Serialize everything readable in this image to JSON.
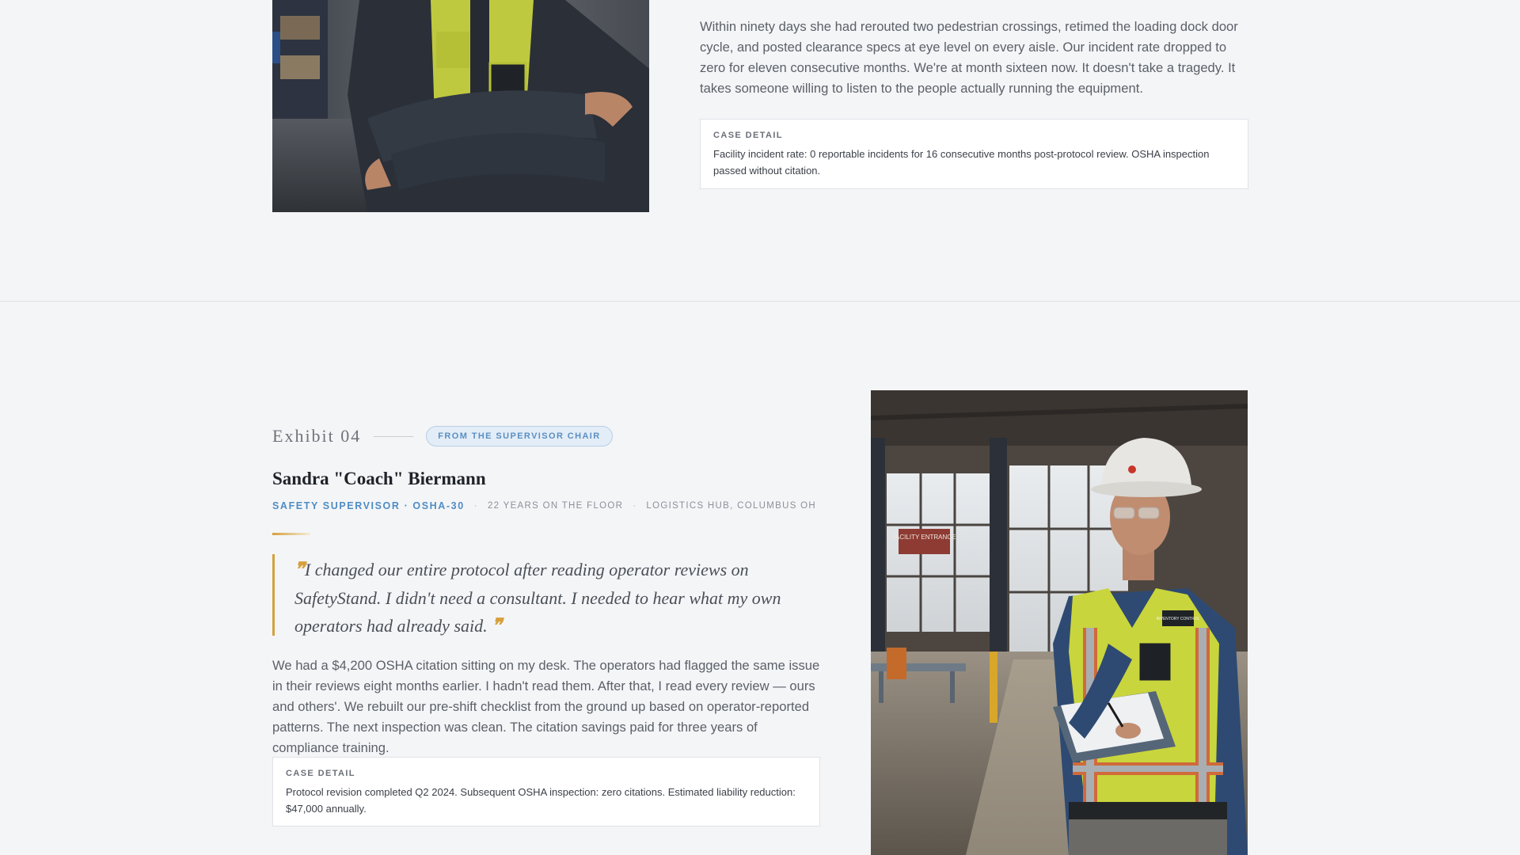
{
  "exhibit_prev": {
    "photo_alt": "Worker in high-visibility vest with arms crossed",
    "body": "Within ninety days she had rerouted two pedestrian crossings, retimed the loading dock door cycle, and posted clearance specs at eye level on every aisle. Our incident rate dropped to zero for eleven consecutive months. We're at month sixteen now. It doesn't take a tragedy. It takes someone willing to listen to the people actually running the equipment.",
    "case_label": "CASE DETAIL",
    "case_text": "Facility incident rate: 0 reportable incidents for 16 consecutive months post-protocol review. OSHA inspection passed without citation."
  },
  "exhibit": {
    "number": "Exhibit 04",
    "badge": "FROM THE SUPERVISOR CHAIR",
    "name": "Sandra \"Coach\" Biermann",
    "role": "SAFETY SUPERVISOR · OSHA-30",
    "tenure": "22 YEARS ON THE FLOOR",
    "location": "LOGISTICS HUB, COLUMBUS OH",
    "quote": "I changed our entire protocol after reading operator reviews on SafetyStand. I didn't need a consultant. I needed to hear what my own operators had already said.",
    "body": "We had a $4,200 OSHA citation sitting on my desk. The operators had flagged the same issue in their reviews eight months earlier. I hadn't read them. After that, I read every review — ours and others'. We rebuilt our pre-shift checklist from the ground up based on operator-reported patterns. The next inspection was clean. The citation savings paid for three years of compliance training.",
    "case_label": "CASE DETAIL",
    "case_text": "Protocol revision completed Q2 2024. Subsequent OSHA inspection: zero citations. Estimated liability reduction: $47,000 annually.",
    "photo_alt": "Safety supervisor in hard hat writing on clipboard in warehouse",
    "photo_sign": "FACILITY ENTRANCE",
    "vest_badge": "INVENTORY CONTROL"
  },
  "colors": {
    "accent_gold": "#d6a03c",
    "accent_blue": "#4f8cc4",
    "page_bg": "#f4f5f7"
  }
}
